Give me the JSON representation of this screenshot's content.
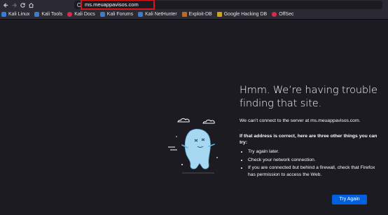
{
  "toolbar": {
    "back_icon": "back-arrow-icon",
    "forward_icon": "forward-arrow-icon",
    "reload_icon": "reload-icon",
    "home_icon": "home-icon",
    "url_scheme": "",
    "url": "ms.meuappavisos.com",
    "url_highlight_color": "#d9141b"
  },
  "bookmarks": [
    {
      "label": "Kali Linux",
      "icon": "kali-dragon-icon"
    },
    {
      "label": "Kali Tools",
      "icon": "kali-dragon-icon"
    },
    {
      "label": "Kali Docs",
      "icon": "kali-docs-icon"
    },
    {
      "label": "Kali Forums",
      "icon": "kali-dragon-icon"
    },
    {
      "label": "Kali NetHunter",
      "icon": "kali-dragon-icon"
    },
    {
      "label": "Exploit-DB",
      "icon": "exploit-db-icon"
    },
    {
      "label": "Google Hacking DB",
      "icon": "ghdb-icon"
    },
    {
      "label": "OffSec",
      "icon": "offsec-icon"
    }
  ],
  "error": {
    "title": "Hmm. We’re having trouble finding that site.",
    "description": "We can’t connect to the server at ms.meuappavisos.com.",
    "hint": "If that address is correct, here are three other things you can try:",
    "tips": [
      "Try again later.",
      "Check your network connection.",
      "If you are connected but behind a firewall, check that Firefox has permission to access the Web."
    ],
    "button_label": "Try Again",
    "illustration_icon": "lost-dinosaur-icon"
  },
  "colors": {
    "page_bg": "#1c1b22",
    "toolbar_bg": "#2b2a33",
    "primary_button": "#0060df",
    "text": "#fbfbfe"
  }
}
